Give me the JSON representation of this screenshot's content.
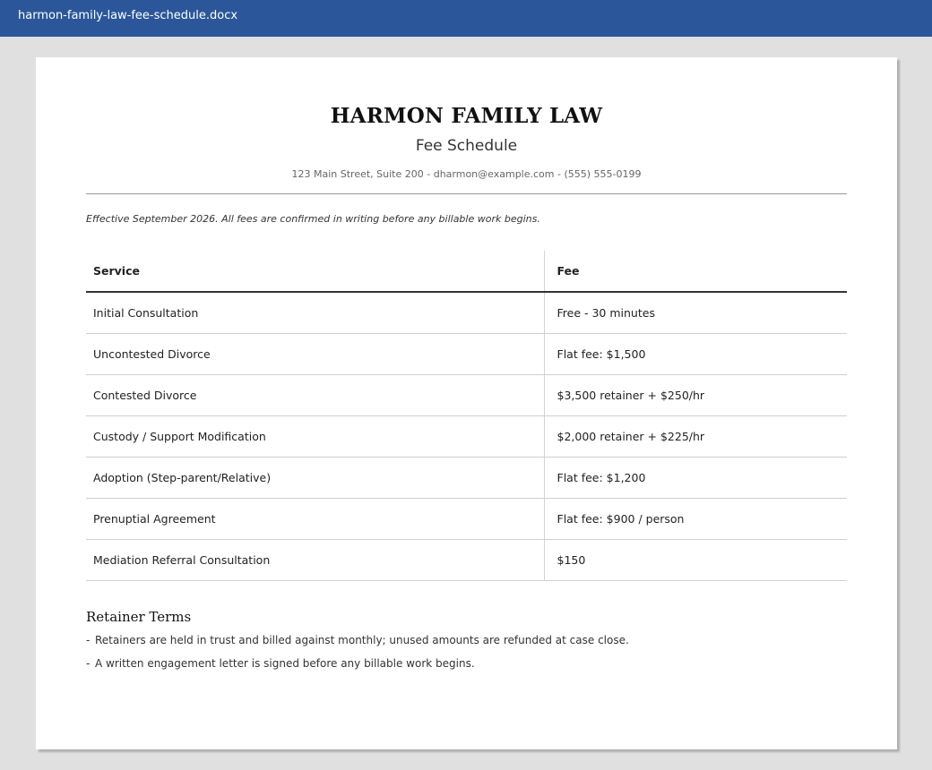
{
  "window": {
    "filename": "harmon-family-law-fee-schedule.docx",
    "accent_color": "#2b579a"
  },
  "document": {
    "firm_name": "HARMON FAMILY LAW",
    "title": "Fee Schedule",
    "contact": "123 Main Street, Suite 200 - dharmon@example.com - (555) 555-0199",
    "effective_note": "Effective September 2026. All fees are confirmed in writing before any billable work begins.",
    "fee_table": {
      "headers": {
        "service": "Service",
        "fee": "Fee"
      },
      "rows": [
        {
          "service": "Initial Consultation",
          "fee": "Free - 30 minutes"
        },
        {
          "service": "Uncontested Divorce",
          "fee": "Flat fee: $1,500"
        },
        {
          "service": "Contested Divorce",
          "fee": "$3,500 retainer + $250/hr"
        },
        {
          "service": "Custody / Support Modification",
          "fee": "$2,000 retainer + $225/hr"
        },
        {
          "service": "Adoption (Step-parent/Relative)",
          "fee": "Flat fee: $1,200"
        },
        {
          "service": "Prenuptial Agreement",
          "fee": "Flat fee: $900 / person"
        },
        {
          "service": "Mediation Referral Consultation",
          "fee": "$150"
        }
      ]
    },
    "retainer_terms": {
      "heading": "Retainer Terms",
      "bullet_marker": "-",
      "items": [
        "Retainers are held in trust and billed against monthly; unused amounts are refunded at case close.",
        "A written engagement letter is signed before any billable work begins."
      ]
    }
  }
}
